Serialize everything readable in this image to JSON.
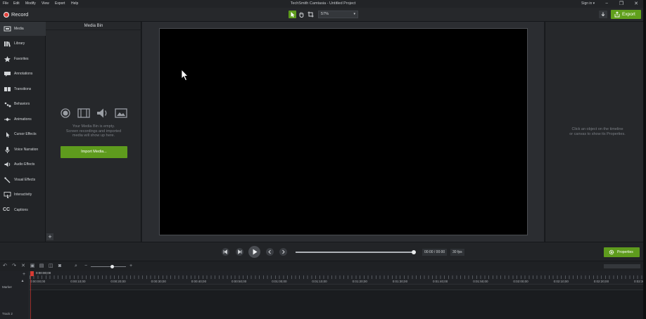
{
  "menu": [
    "File",
    "Edit",
    "Modify",
    "View",
    "Export",
    "Help"
  ],
  "app_title": "TechSmith Camtasia - Untitled Project",
  "account": {
    "signin": "Sign in ▾"
  },
  "toolbar": {
    "record_label": "Record",
    "zoom_value": "57%",
    "export_label": "Export"
  },
  "sidebar": {
    "items": [
      {
        "label": "Media",
        "icon": "media-icon"
      },
      {
        "label": "Library",
        "icon": "library-icon"
      },
      {
        "label": "Favorites",
        "icon": "star-icon"
      },
      {
        "label": "Annotations",
        "icon": "annotations-icon"
      },
      {
        "label": "Transitions",
        "icon": "transitions-icon"
      },
      {
        "label": "Behaviors",
        "icon": "behaviors-icon"
      },
      {
        "label": "Animations",
        "icon": "animations-icon"
      },
      {
        "label": "Cursor Effects",
        "icon": "cursor-effects-icon"
      },
      {
        "label": "Voice Narration",
        "icon": "microphone-icon"
      },
      {
        "label": "Audio Effects",
        "icon": "speaker-icon"
      },
      {
        "label": "Visual Effects",
        "icon": "wand-icon"
      },
      {
        "label": "Interactivity",
        "icon": "interactivity-icon"
      },
      {
        "label": "Captions",
        "icon": "captions-icon"
      }
    ]
  },
  "mediabin": {
    "title": "Media Bin",
    "empty_line1": "Your Media Bin is empty.",
    "empty_line2": "Screen recordings and imported",
    "empty_line3": "media will show up here.",
    "import_label": "Import Media..."
  },
  "properties": {
    "hint_line1": "Click an object on the timeline",
    "hint_line2": "or canvas to show its Properties."
  },
  "playback": {
    "time": "00:00 / 00:00",
    "fps": "30 fps",
    "progress": 1.0,
    "properties_label": "Properties"
  },
  "timeline": {
    "zoom_level": 0.6,
    "playhead_time": "0:00:00;00",
    "ticks": [
      "0:00:00;00",
      "0:00:10;00",
      "0:00:20;00",
      "0:00:30;00",
      "0:00:40;00",
      "0:00:50;00",
      "0:01:00;00",
      "0:01:10;00",
      "0:01:20;00",
      "0:01:30;00",
      "0:01:40;00",
      "0:01:50;00",
      "0:02:00;00",
      "0:02:10;00",
      "0:02:20;00",
      "0:02:30;00"
    ],
    "marker_label": "Marker",
    "track_label": "Track 2"
  },
  "colors": {
    "accent_green": "#5e9b1d",
    "record_red": "#e0413b",
    "playhead_red": "#d63a33"
  }
}
